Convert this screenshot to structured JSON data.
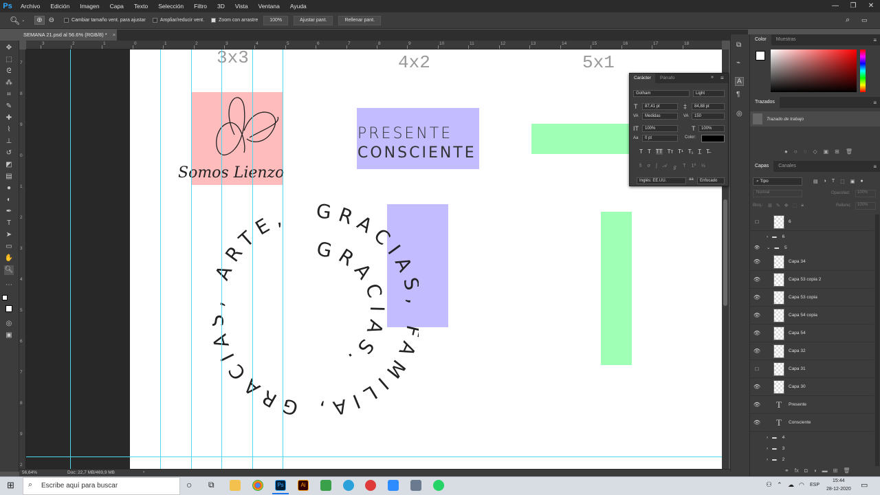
{
  "app": {
    "logo": "Ps"
  },
  "menu": [
    "Archivo",
    "Edición",
    "Imagen",
    "Capa",
    "Texto",
    "Selección",
    "Filtro",
    "3D",
    "Vista",
    "Ventana",
    "Ayuda"
  ],
  "options": {
    "resize_label": "Cambiar tamaño vent. para ajustar",
    "enlarge_label": "Ampliar/reducir vent.",
    "scrub_label": "Zoom con arrastre",
    "zoom_value": "100%",
    "fit_label": "Ajustar pant.",
    "fill_label": "Rellenar pant."
  },
  "document": {
    "tab": "SEMANA 21.psd al 56.6% (RGB/8) *"
  },
  "ruler_top": [
    "3",
    "2",
    "1",
    "0",
    "1",
    "2",
    "3",
    "4",
    "5",
    "6",
    "7",
    "8",
    "9",
    "10",
    "11",
    "12",
    "13",
    "14",
    "15",
    "16",
    "17",
    "18"
  ],
  "ruler_left": [
    "7",
    "8",
    "9",
    "0",
    "1",
    "2",
    "3",
    "4",
    "5",
    "6",
    "7",
    "8",
    "9",
    "2"
  ],
  "canvas": {
    "label_3x3": "3x3",
    "label_4x2": "4x2",
    "label_5x1": "5x1",
    "logo_text": "Somos Lienzo",
    "presente": "PRESENTE",
    "consciente": "CONSCIENTE",
    "outer_ring_text": "GRACIAS, FAMILIA, GRACIAS, ARTE,",
    "inner_ring_text": "GRACIAS.",
    "colors": {
      "pink": "#ffbcbc",
      "purple": "#c3bcff",
      "green": "#9effb5",
      "guide": "#4fd8ee"
    }
  },
  "status": {
    "zoom": "56,64%",
    "doc": "Doc: 22,7 MB/469,9 MB"
  },
  "character_panel": {
    "tabs": [
      "Carácter",
      "Párrafo"
    ],
    "font_family": "Gotham",
    "font_style": "Light",
    "size": "87,41 pt",
    "leading": "84,88 pt",
    "kerning": "Medidas",
    "tracking": "150",
    "vscale": "100%",
    "hscale": "100%",
    "baseline": "0 pt",
    "color_label": "Color:",
    "language": "Inglés: EE.UU.",
    "antialias": "Enfocado"
  },
  "color_panel": {
    "tabs": [
      "Color",
      "Muestras"
    ]
  },
  "paths_panel": {
    "title": "Trazados",
    "item": "Trazado de trabajo"
  },
  "layers_panel": {
    "tabs": [
      "Capas",
      "Canales"
    ],
    "filter": "Tipo",
    "blend": "Normal",
    "opacity_label": "Opacidad:",
    "opacity": "100%",
    "lock_label": "Bloq.:",
    "fill_label": "Relleno:",
    "fill": "100%",
    "layers": [
      {
        "name": "6",
        "kind": "pixel",
        "visible": false
      },
      {
        "name": "6",
        "kind": "group",
        "visible": false
      },
      {
        "name": "5",
        "kind": "group-open",
        "visible": true
      },
      {
        "name": "Capa 34",
        "kind": "smart",
        "visible": true
      },
      {
        "name": "Capa 53 copia 2",
        "kind": "pixel",
        "visible": true
      },
      {
        "name": "Capa 53 copia",
        "kind": "pixel",
        "visible": true
      },
      {
        "name": "Capa 54 copia",
        "kind": "pixel",
        "visible": true
      },
      {
        "name": "Capa 54",
        "kind": "pixel",
        "visible": true
      },
      {
        "name": "Capa 32",
        "kind": "pixel",
        "visible": true
      },
      {
        "name": "Capa 31",
        "kind": "pixel",
        "visible": false
      },
      {
        "name": "Capa 30",
        "kind": "smart",
        "visible": true
      },
      {
        "name": "Presente",
        "kind": "text",
        "visible": true
      },
      {
        "name": "Consciente",
        "kind": "text",
        "visible": true
      },
      {
        "name": "4",
        "kind": "group",
        "visible": false
      },
      {
        "name": "3",
        "kind": "group",
        "visible": false
      },
      {
        "name": "2",
        "kind": "group",
        "visible": false
      }
    ]
  },
  "taskbar": {
    "search_placeholder": "Escribe aquí para buscar",
    "lang": "ESP",
    "time": "15:44",
    "date": "28-12-2020"
  }
}
